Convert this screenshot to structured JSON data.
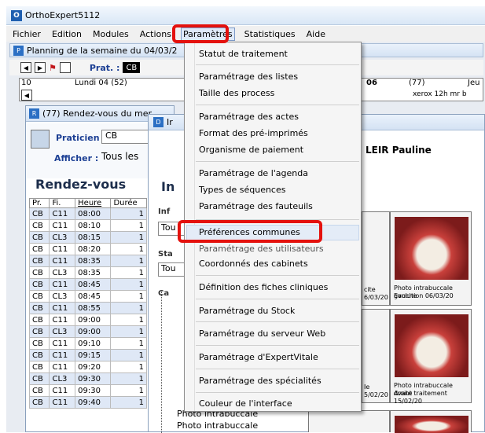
{
  "window": {
    "title": "OrthoExpert5112"
  },
  "menubar": {
    "items": [
      "Fichier",
      "Edition",
      "Modules",
      "Actions",
      "Paramètres",
      "Statistiques",
      "Aide"
    ]
  },
  "planning": {
    "title": "Planning de la semaine du 04/03/2",
    "prat_label": "Prat. :",
    "prat_value": "CB",
    "day_left": "10",
    "day_left_label": "Lundi 04   (52)",
    "day_right": "06",
    "day_right_count": "(77)",
    "day_right_label": "Jeu",
    "note": "xerox 12h mr b"
  },
  "rdv": {
    "title": "(77) Rendez-vous du  mer",
    "praticien_label": "Praticien",
    "praticien_value": "CB",
    "afficher_label": "Afficher :",
    "afficher_value": "Tous les",
    "heading": "Rendez-vous",
    "columns": [
      "Pr.",
      "Fi.",
      "Heure",
      "Durée"
    ],
    "rows": [
      [
        "CB",
        "C11",
        "08:00",
        "1"
      ],
      [
        "CB",
        "C11",
        "08:10",
        "1"
      ],
      [
        "CB",
        "CL3",
        "08:15",
        "1"
      ],
      [
        "CB",
        "C11",
        "08:20",
        "1"
      ],
      [
        "CB",
        "C11",
        "08:35",
        "1"
      ],
      [
        "CB",
        "CL3",
        "08:35",
        "1"
      ],
      [
        "CB",
        "C11",
        "08:45",
        "1"
      ],
      [
        "CB",
        "CL3",
        "08:45",
        "1"
      ],
      [
        "CB",
        "C11",
        "08:55",
        "1"
      ],
      [
        "CB",
        "C11",
        "09:00",
        "1"
      ],
      [
        "CB",
        "CL3",
        "09:00",
        "1"
      ],
      [
        "CB",
        "C11",
        "09:10",
        "1"
      ],
      [
        "CB",
        "C11",
        "09:15",
        "1"
      ],
      [
        "CB",
        "C11",
        "09:20",
        "1"
      ],
      [
        "CB",
        "CL3",
        "09:30",
        "1"
      ],
      [
        "CB",
        "C11",
        "09:30",
        "1"
      ],
      [
        "CB",
        "C11",
        "09:40",
        "1"
      ]
    ]
  },
  "detail": {
    "title": "Ir",
    "big_label": "In",
    "label_1": "Inf",
    "value_1": "Tou",
    "label_2": "Sta",
    "value_2": "Tou",
    "label_3": "Ca",
    "patient": "LEIR Pauline",
    "tree_items": [
      "Photo intrabuccale",
      "Photo intrabuccale"
    ],
    "photos": [
      {
        "caption": "Photo intrabuccale gauche",
        "caption2": "Evolution       06/03/20"
      },
      {
        "caption": "Photo intrabuccale droite",
        "caption2": "Avant traitement 15/02/20"
      }
    ],
    "edge_captions": [
      "cite",
      "6/03/20",
      "Ie",
      "5/02/20"
    ]
  },
  "dropdown": {
    "items": [
      "Statut de traitement",
      "Paramétrage des listes",
      "Taille des process",
      "Paramétrage des actes",
      "Format des pré-imprimés",
      "Organisme de paiement",
      "Paramétrage de l'agenda",
      "Types de séquences",
      "Paramétrage des fauteuils",
      "Préférences communes",
      "Paramétrage des utilisateurs",
      "Coordonnés des cabinets",
      "Définition des fiches cliniques",
      "Paramétrage du Stock",
      "Paramétrage  du serveur Web",
      "Paramétrage d'ExpertVitale",
      "Paramétrage des spécialités",
      "Couleur de l'interface"
    ]
  },
  "colors": {
    "highlight_red": "#e4110d",
    "menu_bg": "#f5f5f5",
    "title_blue": "#1c3f94"
  }
}
